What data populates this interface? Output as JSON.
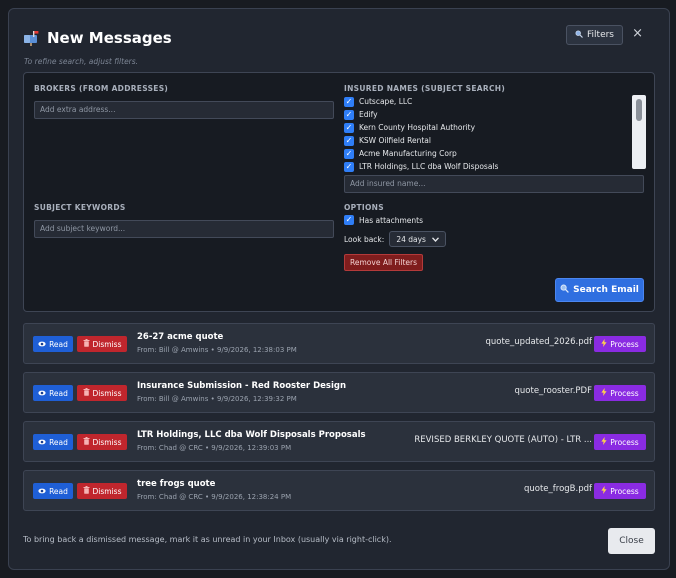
{
  "header": {
    "title": "New Messages",
    "title_icon": "mailbox-icon",
    "filters_label": "Filters",
    "close_glyph": "×",
    "hint": "To refine search, adjust filters."
  },
  "filters": {
    "brokers_label": "BROKERS (FROM ADDRESSES)",
    "brokers_placeholder": "Add extra address...",
    "insured_label": "INSURED NAMES (SUBJECT SEARCH)",
    "insured_names": [
      {
        "label": "Cutscape, LLC",
        "checked": true
      },
      {
        "label": "Edify",
        "checked": true
      },
      {
        "label": "Kern County Hospital Authority",
        "checked": true
      },
      {
        "label": "KSW Oilfield Rental",
        "checked": true
      },
      {
        "label": "Acme Manufacturing Corp",
        "checked": true
      },
      {
        "label": "LTR Holdings, LLC dba Wolf Disposals",
        "checked": true
      }
    ],
    "insured_placeholder": "Add insured name...",
    "subject_label": "SUBJECT KEYWORDS",
    "subject_placeholder": "Add subject keyword...",
    "options_label": "OPTIONS",
    "has_attachments_label": "Has attachments",
    "has_attachments_checked": true,
    "look_back_label": "Look back:",
    "look_back_value": "24 days",
    "remove_all_label": "Remove All Filters",
    "search_label": "Search Email"
  },
  "messages": [
    {
      "subject": "26-27 acme quote",
      "from": "From: Bill @ Amwins • 9/9/2026, 12:38:03 PM",
      "attachment": "quote_updated_2026.pdf"
    },
    {
      "subject": "Insurance Submission - Red Rooster Design",
      "from": "From: Bill @ Amwins • 9/9/2026, 12:39:32 PM",
      "attachment": "quote_rooster.PDF"
    },
    {
      "subject": "LTR Holdings, LLC dba Wolf Disposals Proposals",
      "from": "From: Chad @ CRC • 9/9/2026, 12:39:03 PM",
      "attachment": "REVISED BERKLEY QUOTE (AUTO) - LTR ..."
    },
    {
      "subject": "tree frogs quote",
      "from": "From: Chad @ CRC • 9/9/2026, 12:38:24 PM",
      "attachment": "quote_frogB.pdf"
    }
  ],
  "buttons": {
    "read": "Read",
    "dismiss": "Dismiss",
    "process": "Process"
  },
  "footer": {
    "text": "To bring back a dismissed message, mark it as unread in your Inbox (usually via right-click).",
    "close_label": "Close"
  },
  "colors": {
    "read_button": "#1f5fd6",
    "dismiss_button": "#c0262d",
    "process_button": "#8a2be2",
    "search_button": "#2f6fe0",
    "checkbox": "#2f7ef7"
  }
}
